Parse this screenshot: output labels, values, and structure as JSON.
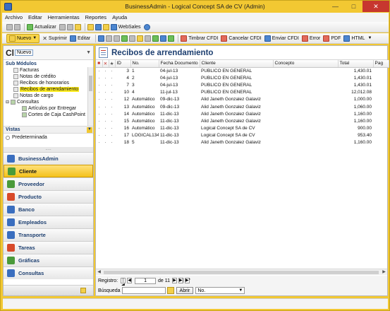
{
  "window": {
    "title": "BusinessAdmin - Logical Concept SA de CV (Admin)"
  },
  "menu": [
    "Archivo",
    "Editar",
    "Herramientas",
    "Reportes",
    "Ayuda"
  ],
  "toolbar1": {
    "actualizar": "Actualizar",
    "websales": "WebSales"
  },
  "toolbar2": {
    "nuevo": "Nuevo",
    "suprimir": "Suprimir",
    "editar": "Editar",
    "timbrar": "Timbrar CFDI",
    "cancelar": "Cancelar CFDI",
    "enviar": "Enviar CFDI",
    "error": "Error",
    "pdf": "PDF",
    "html": "HTML"
  },
  "sidebar": {
    "header_big": "Cl",
    "header_combo": "Nuevo",
    "modules_title": "Sub Módulos",
    "modules": [
      {
        "label": "Facturas",
        "level": 1,
        "selected": false
      },
      {
        "label": "Notas de crédito",
        "level": 1,
        "selected": false
      },
      {
        "label": "Recibos de honorarios",
        "level": 1,
        "selected": false
      },
      {
        "label": "Recibos de arrendamiento",
        "level": 1,
        "selected": true
      },
      {
        "label": "Notas de cargo",
        "level": 1,
        "selected": false
      },
      {
        "label": "Consultas",
        "level": 0,
        "selected": false
      },
      {
        "label": "Artículos por Entregar",
        "level": 2,
        "selected": false
      },
      {
        "label": "Cortes de Caja CashPoint",
        "level": 2,
        "selected": false
      }
    ],
    "vistas_title": "Vistas",
    "vista_default": "Predeterminada",
    "nav": [
      {
        "label": "BusinessAdmin",
        "active": false,
        "color": "#3a6ebf"
      },
      {
        "label": "Cliente",
        "active": true,
        "color": "#4a9a3a"
      },
      {
        "label": "Proveedor",
        "active": false,
        "color": "#4a9a3a"
      },
      {
        "label": "Producto",
        "active": false,
        "color": "#d84a2a"
      },
      {
        "label": "Banco",
        "active": false,
        "color": "#3a6ebf"
      },
      {
        "label": "Empleados",
        "active": false,
        "color": "#3a6ebf"
      },
      {
        "label": "Transporte",
        "active": false,
        "color": "#3a6ebf"
      },
      {
        "label": "Tareas",
        "active": false,
        "color": "#d84a2a"
      },
      {
        "label": "Gráficas",
        "active": false,
        "color": "#4a9a3a"
      },
      {
        "label": "Consultas",
        "active": false,
        "color": "#3a6ebf"
      }
    ]
  },
  "main": {
    "title": "Recibos de arrendamiento",
    "columns": [
      "ID",
      "No.",
      "Fecha Documento",
      "Cliente",
      "Concepto",
      "Total",
      "Pag"
    ],
    "rows": [
      {
        "id": "3",
        "no": "1",
        "fecha": "04-jul-13",
        "cliente": "PUBLICO EN GENERAL",
        "concepto": "",
        "total": "1,430.01"
      },
      {
        "id": "4",
        "no": "2",
        "fecha": "04-jul-13",
        "cliente": "PUBLICO EN GENERAL",
        "concepto": "",
        "total": "1,430.01"
      },
      {
        "id": "7",
        "no": "3",
        "fecha": "04-jul-13",
        "cliente": "PUBLICO EN GENERAL",
        "concepto": "",
        "total": "1,430.01"
      },
      {
        "id": "10",
        "no": "4",
        "fecha": "11-jul-13",
        "cliente": "PUBLICO EN GENERAL",
        "concepto": "",
        "total": "12,012.08"
      },
      {
        "id": "12",
        "no": "Automático",
        "fecha": "09-dic-13",
        "cliente": "Alid Janeth Gonzalez Galaviz",
        "concepto": "",
        "total": "1,000.00"
      },
      {
        "id": "13",
        "no": "Automático",
        "fecha": "09-dic-13",
        "cliente": "Alid Janeth Gonzalez Galaviz",
        "concepto": "",
        "total": "1,060.00"
      },
      {
        "id": "14",
        "no": "Automático",
        "fecha": "11-dic-13",
        "cliente": "Alid Janeth Gonzalez Galaviz",
        "concepto": "",
        "total": "1,160.00"
      },
      {
        "id": "15",
        "no": "Automático",
        "fecha": "11-dic-13",
        "cliente": "Alid Janeth Gonzalez Galaviz",
        "concepto": "",
        "total": "1,160.00"
      },
      {
        "id": "16",
        "no": "Automático",
        "fecha": "11-dic-13",
        "cliente": "Logical Concept SA de CV",
        "concepto": "",
        "total": "900.00"
      },
      {
        "id": "17",
        "no": "LOGICAL134",
        "fecha": "11-dic-13",
        "cliente": "Logical Concept SA de CV",
        "concepto": "",
        "total": "953.40"
      },
      {
        "id": "18",
        "no": "5",
        "fecha": "11-dic-13",
        "cliente": "Alid Janeth Gonzalez Galaviz",
        "concepto": "",
        "total": "1,160.00"
      }
    ],
    "pager": {
      "label": "Registro:",
      "current": "1",
      "of_label": "de 11"
    },
    "search": {
      "label": "Búsqueda",
      "button": "Abrir",
      "select": "No."
    }
  },
  "colors": {
    "chrome": "#f2c832",
    "accent": "#1d3f70",
    "selected": "#ffec1f"
  }
}
